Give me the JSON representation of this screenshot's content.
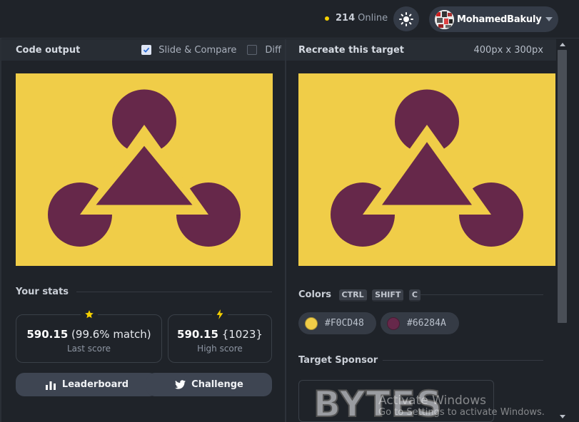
{
  "header": {
    "online_count": "214",
    "online_label": "Online",
    "username": "MohamedBakuly"
  },
  "left_panel": {
    "title": "Code output",
    "slide_compare_label": "Slide & Compare",
    "slide_compare_checked": true,
    "diff_label": "Diff",
    "diff_checked": false
  },
  "right_panel": {
    "title": "Recreate this target",
    "dimensions": "400px x 300px"
  },
  "stats": {
    "heading": "Your stats",
    "last_score_value": "590.15",
    "last_score_match": "(99.6% match)",
    "last_score_label": "Last score",
    "high_score_value": "590.15",
    "high_score_extra": "{1023}",
    "high_score_label": "High score"
  },
  "buttons": {
    "leaderboard": "Leaderboard",
    "challenge": "Challenge"
  },
  "colors": {
    "heading": "Colors",
    "keys": [
      "CTRL",
      "SHIFT",
      "C"
    ],
    "swatches": [
      {
        "hex": "#F0CD48"
      },
      {
        "hex": "#66284A"
      }
    ]
  },
  "sponsor": {
    "heading": "Target Sponsor",
    "logo_text": "BYTES"
  },
  "watermark": {
    "line1": "Activate Windows",
    "line2": "Go to Settings to activate Windows."
  },
  "theme": {
    "target_yellow": "#F0CD48",
    "target_purple": "#66284A",
    "bg": "#1f2329"
  }
}
